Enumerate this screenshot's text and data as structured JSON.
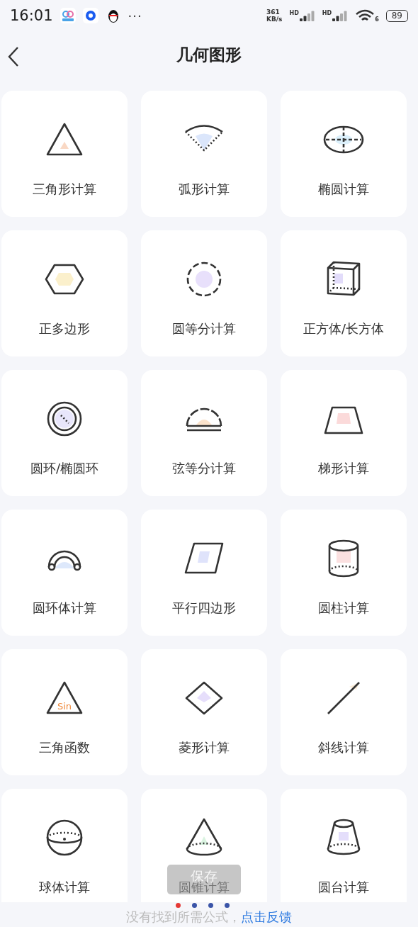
{
  "status_bar": {
    "time": "16:01",
    "more": "···",
    "speed_value": "361",
    "speed_unit": "KB/s",
    "sim_labels": [
      "HD",
      "HD"
    ],
    "wifi_label": "6",
    "battery": "89"
  },
  "header": {
    "title": "几何图形"
  },
  "items": [
    {
      "label": "三角形计算",
      "kind": "triangle"
    },
    {
      "label": "弧形计算",
      "kind": "sector"
    },
    {
      "label": "椭圆计算",
      "kind": "ellipse"
    },
    {
      "label": "正多边形",
      "kind": "hexagon"
    },
    {
      "label": "圆等分计算",
      "kind": "dashed-circle"
    },
    {
      "label": "正方体/长方体",
      "kind": "cube"
    },
    {
      "label": "圆环/椭圆环",
      "kind": "ring"
    },
    {
      "label": "弦等分计算",
      "kind": "semicircle"
    },
    {
      "label": "梯形计算",
      "kind": "trapezoid"
    },
    {
      "label": "圆环体计算",
      "kind": "torus"
    },
    {
      "label": "平行四边形",
      "kind": "parallelogram"
    },
    {
      "label": "圆柱计算",
      "kind": "cylinder"
    },
    {
      "label": "三角函数",
      "kind": "sin-triangle",
      "icon_text": "Sin"
    },
    {
      "label": "菱形计算",
      "kind": "rhombus"
    },
    {
      "label": "斜线计算",
      "kind": "line"
    },
    {
      "label": "球体计算",
      "kind": "sphere"
    },
    {
      "label": "圆锥计算",
      "kind": "cone"
    },
    {
      "label": "圆台计算",
      "kind": "frustum"
    }
  ],
  "toast": "保存",
  "footer": {
    "text": "没有找到所需公式，",
    "link": "点击反馈"
  },
  "loading_dots": [
    {
      "color": "#e53935"
    },
    {
      "color": "#3b55a8"
    },
    {
      "color": "#3b55a8"
    },
    {
      "color": "#3b55a8"
    }
  ]
}
